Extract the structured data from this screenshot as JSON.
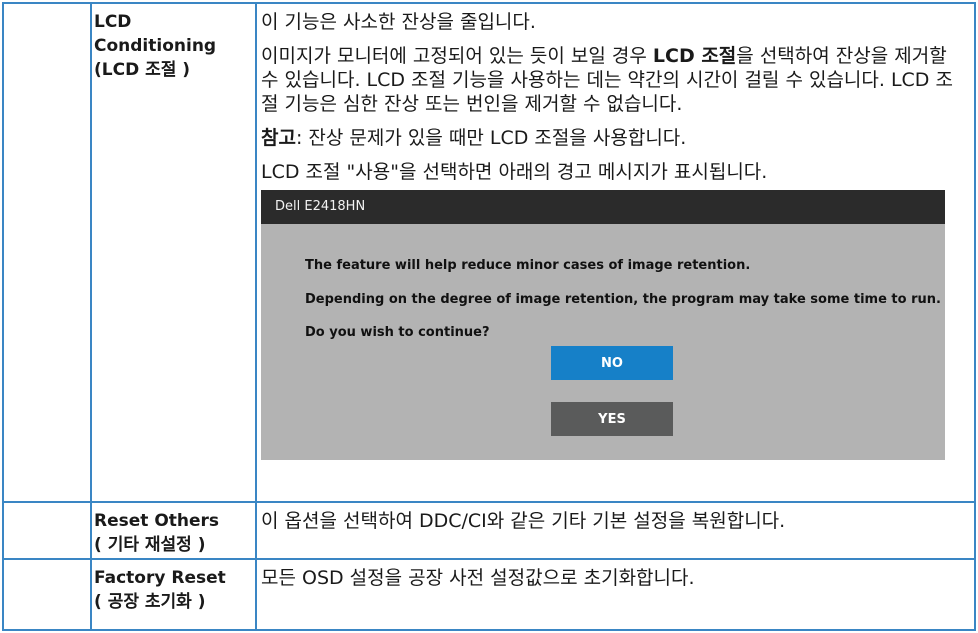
{
  "rows": [
    {
      "label_en": [
        "LCD",
        "Conditioning",
        "(LCD 조절 )"
      ],
      "paragraphs": [
        "이 기능은 사소한 잔상을 줄입니다.",
        "이미지가 모니터에 고정되어 있는 듯이 보일 경우 ",
        "LCD 조절",
        "을 선택하여 잔상을 제거할 수 있습니다. LCD 조절 기능을 사용하는 데는 약간의 시간이 걸릴 수 있습니다. LCD 조절 기능은 심한 잔상 또는 번인을 제거할 수 없습니다.",
        "참고",
        ": 잔상 문제가 있을 때만 LCD 조절을 사용합니다.",
        "LCD 조절 \"사용\"을 선택하면 아래의 경고 메시지가 표시됩니다."
      ],
      "osd": {
        "title": "Dell E2418HN",
        "line1": "The feature will help reduce minor cases of image retention.",
        "line2": "Depending on the degree of image retention, the program may take some time to run.",
        "line3": "Do you wish to continue?",
        "no_label": "NO",
        "yes_label": "YES"
      }
    },
    {
      "label_en": "Reset Others",
      "label_ko": "( 기타 재설정 )",
      "desc": "이 옵션을 선택하여 DDC/CI와 같은 기타 기본 설정을 복원합니다."
    },
    {
      "label_en": "Factory Reset",
      "label_ko": "( 공장 초기화 )",
      "desc": "모든 OSD 설정을 공장 사전 설정값으로 초기화합니다."
    }
  ],
  "colors": {
    "border": "#3a86c4",
    "osd_bg": "#b3b3b3",
    "osd_bar": "#2b2b2b",
    "no_button": "#1680c8",
    "yes_button": "#5a5b5b"
  }
}
